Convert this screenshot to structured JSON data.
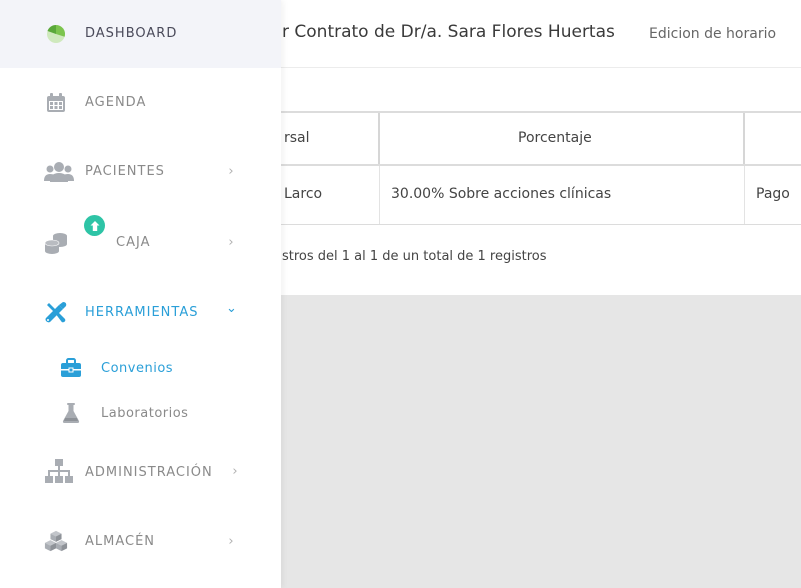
{
  "header": {
    "title": "r Contrato de Dr/a. Sara Flores Huertas",
    "subtitle": "Edicion de horario"
  },
  "table": {
    "headers": [
      "rsal",
      "Porcentaje",
      ""
    ],
    "rows": [
      [
        "Larco",
        "30.00% Sobre acciones clínicas",
        "Pago"
      ]
    ],
    "info": "stros del 1 al 1 de un total de 1 registros"
  },
  "sidebar": {
    "items": [
      {
        "label": "DASHBOARD",
        "icon": "pie-chart-icon"
      },
      {
        "label": "AGENDA",
        "icon": "calendar-icon"
      },
      {
        "label": "PACIENTES",
        "icon": "users-icon",
        "chevron": "›"
      },
      {
        "label": "CAJA",
        "icon": "coins-icon",
        "chevron": "›"
      },
      {
        "label": "HERRAMIENTAS",
        "icon": "tools-icon",
        "chevron": "⌄"
      },
      {
        "label": "ADMINISTRACIÓN",
        "icon": "sitemap-icon",
        "chevron": "›"
      },
      {
        "label": "ALMACÉN",
        "icon": "boxes-icon",
        "chevron": "›"
      }
    ],
    "subitems": [
      {
        "label": "Convenios",
        "icon": "briefcase-icon"
      },
      {
        "label": "Laboratorios",
        "icon": "flask-icon"
      }
    ]
  },
  "colors": {
    "accent": "#2a9fd8",
    "badge": "#2ec4a6",
    "dashboard_green": "#7cc44e",
    "icon_gray": "#a9adb3",
    "text_dark": "#3a3a3a"
  }
}
